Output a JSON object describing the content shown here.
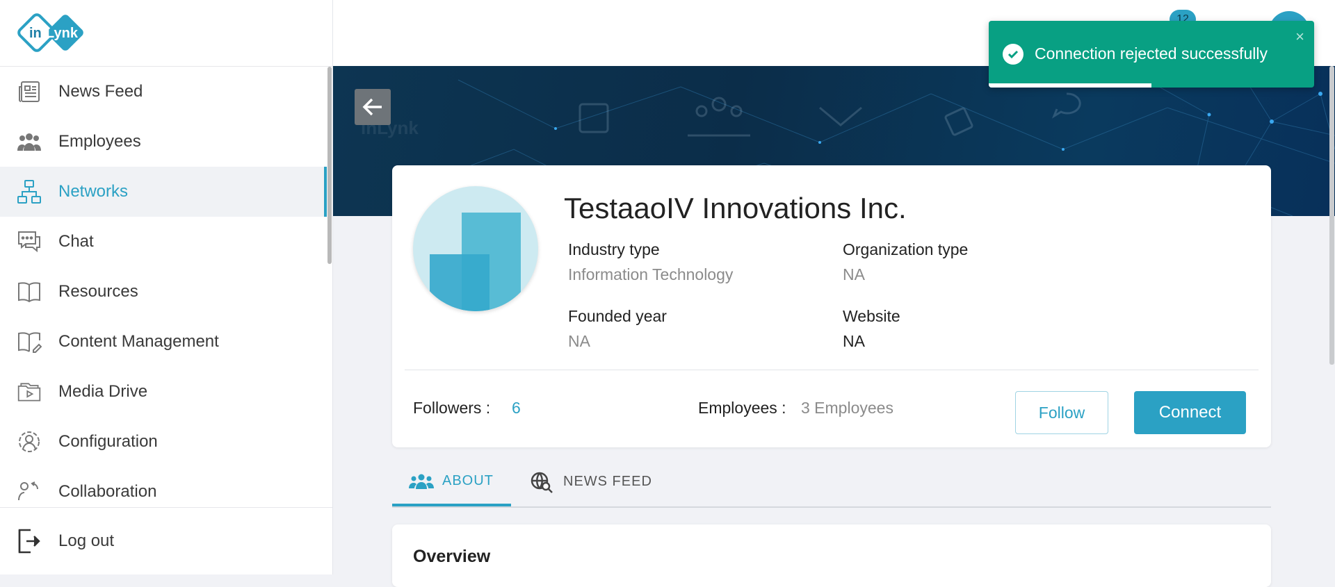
{
  "brand": {
    "logo_text": "inLynk"
  },
  "sidebar": {
    "items": [
      {
        "label": "News Feed",
        "icon": "newspaper-icon"
      },
      {
        "label": "Employees",
        "icon": "people-icon"
      },
      {
        "label": "Networks",
        "icon": "network-icon",
        "active": true
      },
      {
        "label": "Chat",
        "icon": "chat-icon"
      },
      {
        "label": "Resources",
        "icon": "book-icon"
      },
      {
        "label": "Content Management",
        "icon": "book-edit-icon"
      },
      {
        "label": "Media Drive",
        "icon": "folder-media-icon"
      },
      {
        "label": "Configuration",
        "icon": "user-gear-icon"
      },
      {
        "label": "Collaboration",
        "icon": "collaboration-icon"
      }
    ],
    "logout_label": "Log out"
  },
  "header": {
    "notification_count": "12"
  },
  "toast": {
    "message": "Connection rejected successfully",
    "close": "×",
    "progress": 0.5
  },
  "company": {
    "name": "TestaaoIV Innovations Inc.",
    "industry_label": "Industry type",
    "industry_value": "Information Technology",
    "org_type_label": "Organization type",
    "org_type_value": "NA",
    "founded_label": "Founded year",
    "founded_value": "NA",
    "website_label": "Website",
    "website_value": "NA",
    "followers_label": "Followers :",
    "followers_value": "6",
    "employees_label": "Employees :",
    "employees_value": "3 Employees",
    "follow_label": "Follow",
    "connect_label": "Connect"
  },
  "tabs": [
    {
      "label": "ABOUT",
      "active": true
    },
    {
      "label": "NEWS FEED",
      "active": false
    }
  ],
  "overview": {
    "title": "Overview"
  },
  "colors": {
    "accent": "#2ba1c4",
    "toast": "#08a083"
  }
}
